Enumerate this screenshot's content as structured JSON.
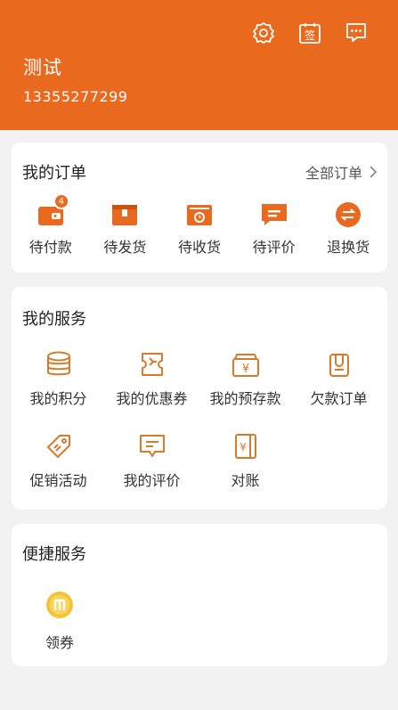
{
  "colors": {
    "accent": "#e96a1e",
    "background": "#f3f2f2",
    "card": "#ffffff"
  },
  "header": {
    "username": "测试",
    "phone": "13355277299",
    "icons": [
      "settings-icon",
      "sign-in-icon",
      "message-icon"
    ],
    "sign_glyph": "签"
  },
  "orders": {
    "title": "我的订单",
    "all_label": "全部订单",
    "items": [
      {
        "label": "待付款",
        "icon": "wallet-icon",
        "badge": "4"
      },
      {
        "label": "待发货",
        "icon": "box-icon"
      },
      {
        "label": "待收货",
        "icon": "delivery-icon"
      },
      {
        "label": "待评价",
        "icon": "comment-icon"
      },
      {
        "label": "退换货",
        "icon": "exchange-icon"
      }
    ]
  },
  "services": {
    "title": "我的服务",
    "items": [
      {
        "label": "我的积分",
        "icon": "coins-icon"
      },
      {
        "label": "我的优惠券",
        "icon": "coupon-icon"
      },
      {
        "label": "我的预存款",
        "icon": "deposit-icon"
      },
      {
        "label": "欠款订单",
        "icon": "debt-order-icon"
      },
      {
        "label": "促销活动",
        "icon": "promotion-tag-icon"
      },
      {
        "label": "我的评价",
        "icon": "review-icon"
      },
      {
        "label": "对账",
        "icon": "reconcile-icon"
      }
    ],
    "currency_glyph": "¥"
  },
  "quick": {
    "title": "便捷服务",
    "items": [
      {
        "label": "领券",
        "icon": "get-coupon-icon"
      }
    ]
  }
}
